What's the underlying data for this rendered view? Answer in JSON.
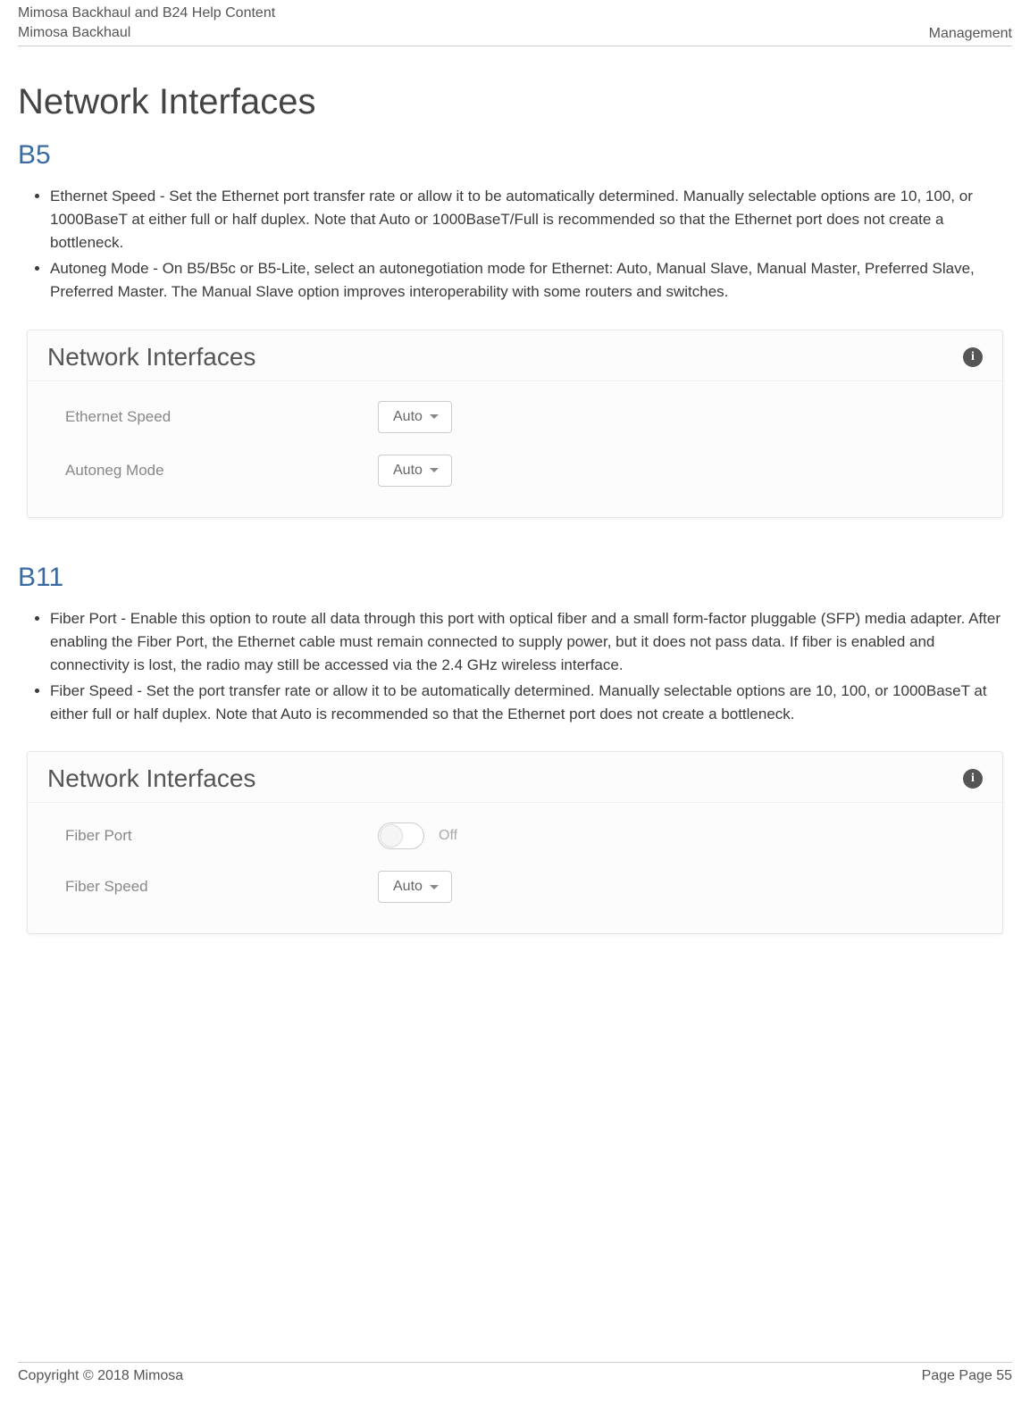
{
  "header": {
    "line1": "Mimosa Backhaul and B24 Help Content",
    "line2": "Mimosa Backhaul",
    "right": "Management"
  },
  "page_title": "Network Interfaces",
  "sections": {
    "b5": {
      "title": "B5",
      "items": [
        "Ethernet Speed - Set the Ethernet port transfer rate or allow it to be automatically determined. Manually selectable options are 10, 100, or 1000BaseT at either full or half duplex. Note that Auto or 1000BaseT/Full is recommended so that the Ethernet port does not create a bottleneck.",
        "Autoneg Mode - On B5/B5c or B5-Lite, select an autonegotiation mode for Ethernet: Auto, Manual Slave, Manual Master, Preferred Slave, Preferred Master. The Manual Slave option improves interoperability with some routers and switches."
      ],
      "panel": {
        "title": "Network Interfaces",
        "rows": {
          "ethernet_speed": {
            "label": "Ethernet Speed",
            "value": "Auto"
          },
          "autoneg_mode": {
            "label": "Autoneg Mode",
            "value": "Auto"
          }
        }
      }
    },
    "b11": {
      "title": "B11",
      "items": [
        "Fiber Port - Enable this option to route all data through this port with optical fiber and a small form-factor pluggable (SFP) media adapter. After enabling the Fiber Port, the Ethernet cable must remain connected to supply power, but it does not pass data. If fiber is enabled and connectivity is lost, the radio may still be accessed via the 2.4 GHz wireless interface.",
        "Fiber Speed - Set the port transfer rate or allow it to be automatically determined. Manually selectable options are 10, 100, or 1000BaseT at either full or half duplex. Note that Auto is recommended so that the Ethernet port does not create a bottleneck."
      ],
      "panel": {
        "title": "Network Interfaces",
        "rows": {
          "fiber_port": {
            "label": "Fiber Port",
            "state": "Off"
          },
          "fiber_speed": {
            "label": "Fiber Speed",
            "value": "Auto"
          }
        }
      }
    }
  },
  "footer": {
    "copyright": "Copyright © 2018 Mimosa",
    "page_label": "Page Page 55"
  }
}
